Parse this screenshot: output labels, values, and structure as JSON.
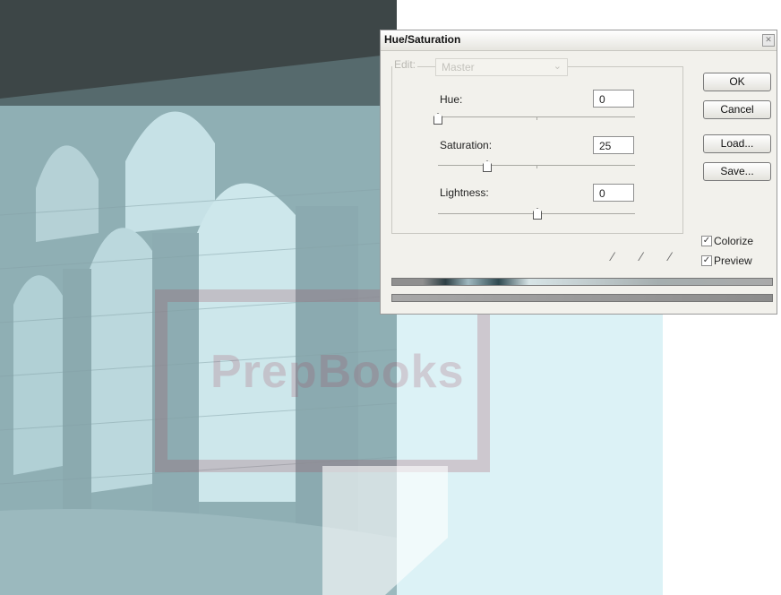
{
  "dialog": {
    "title": "Hue/Saturation",
    "edit_label": "Edit:",
    "edit_value": "Master",
    "hue": {
      "label": "Hue:",
      "value": "0",
      "level": 0.0
    },
    "saturation": {
      "label": "Saturation:",
      "value": "25",
      "level": 0.25
    },
    "lightness": {
      "label": "Lightness:",
      "value": "0",
      "level": 0.5
    },
    "buttons": {
      "ok": "OK",
      "cancel": "Cancel",
      "load": "Load...",
      "save": "Save..."
    },
    "colorize": {
      "label": "Colorize",
      "checked": true
    },
    "preview": {
      "label": "Preview",
      "checked": true
    }
  },
  "watermark": {
    "text": "PrepBooks"
  },
  "colors": {
    "overlay_cyan": "#bfe7ef",
    "tint": "#8fb7bf",
    "watermark_red": "#a04a5a"
  },
  "icons": [
    "eyedropper-icon",
    "eyedropper-plus-icon",
    "eyedropper-minus-icon",
    "close-icon",
    "chevron-down-icon"
  ]
}
